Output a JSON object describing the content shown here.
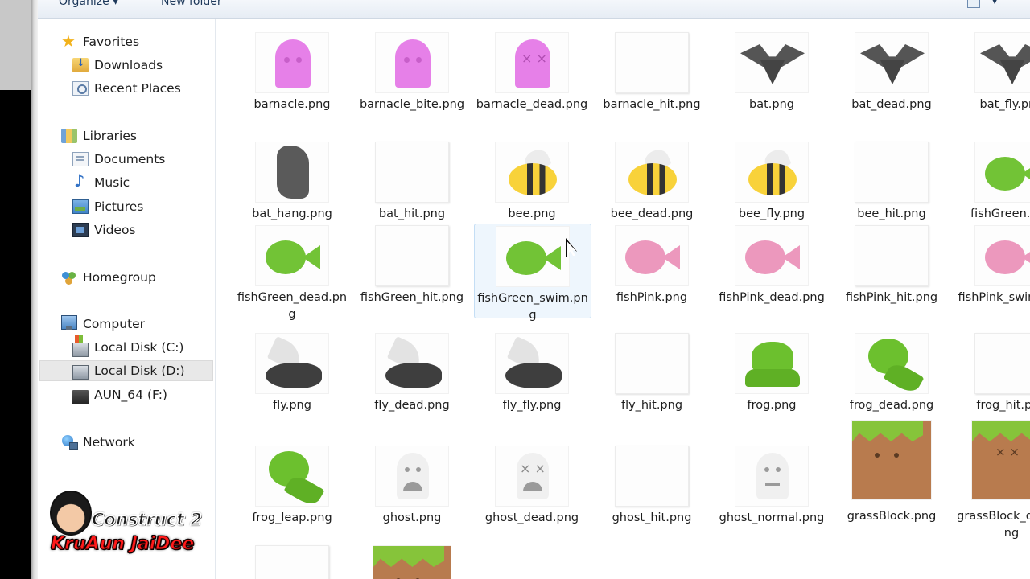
{
  "toolbar": {
    "organize_label": "Organize ▾",
    "new_folder_label": "New folder"
  },
  "nav": {
    "favorites": "Favorites",
    "downloads": "Downloads",
    "recent_places": "Recent Places",
    "libraries": "Libraries",
    "documents": "Documents",
    "music": "Music",
    "pictures": "Pictures",
    "videos": "Videos",
    "homegroup": "Homegroup",
    "computer": "Computer",
    "local_disk_c": "Local Disk (C:)",
    "local_disk_d": "Local Disk (D:)",
    "aun64": "AUN_64 (F:)",
    "network": "Network"
  },
  "logo": {
    "line1": "Construct 2",
    "line2": "KruAun JaiDee"
  },
  "files": [
    {
      "name": "barnacle.png"
    },
    {
      "name": "barnacle_bite.png"
    },
    {
      "name": "barnacle_dead.png"
    },
    {
      "name": "barnacle_hit.png"
    },
    {
      "name": "bat.png"
    },
    {
      "name": "bat_dead.png"
    },
    {
      "name": "bat_fly.png"
    },
    {
      "name": "bat_hang.png"
    },
    {
      "name": "bat_hit.png"
    },
    {
      "name": "bee.png"
    },
    {
      "name": "bee_dead.png"
    },
    {
      "name": "bee_fly.png"
    },
    {
      "name": "bee_hit.png"
    },
    {
      "name": "fishGreen.png"
    },
    {
      "name": "fishGreen_dead.png"
    },
    {
      "name": "fishGreen_hit.png"
    },
    {
      "name": "fishGreen_swim.png"
    },
    {
      "name": "fishPink.png"
    },
    {
      "name": "fishPink_dead.png"
    },
    {
      "name": "fishPink_hit.png"
    },
    {
      "name": "fishPink_swim.png"
    },
    {
      "name": "fly.png"
    },
    {
      "name": "fly_dead.png"
    },
    {
      "name": "fly_fly.png"
    },
    {
      "name": "fly_hit.png"
    },
    {
      "name": "frog.png"
    },
    {
      "name": "frog_dead.png"
    },
    {
      "name": "frog_hit.png"
    },
    {
      "name": "frog_leap.png"
    },
    {
      "name": "ghost.png"
    },
    {
      "name": "ghost_dead.png"
    },
    {
      "name": "ghost_hit.png"
    },
    {
      "name": "ghost_normal.png"
    },
    {
      "name": "grassBlock.png"
    },
    {
      "name": "grassBlock_dead.png"
    }
  ],
  "colors": {
    "selection": "#e8e8e8",
    "hover": "#eef6fd",
    "barnacle": "#e680e8",
    "fish_green": "#72c336",
    "fish_pink": "#ec98bd",
    "frog": "#6cc02e",
    "grass_top": "#86c43a",
    "dirt": "#b87b4e",
    "logo_red": "#ff1a1a"
  }
}
